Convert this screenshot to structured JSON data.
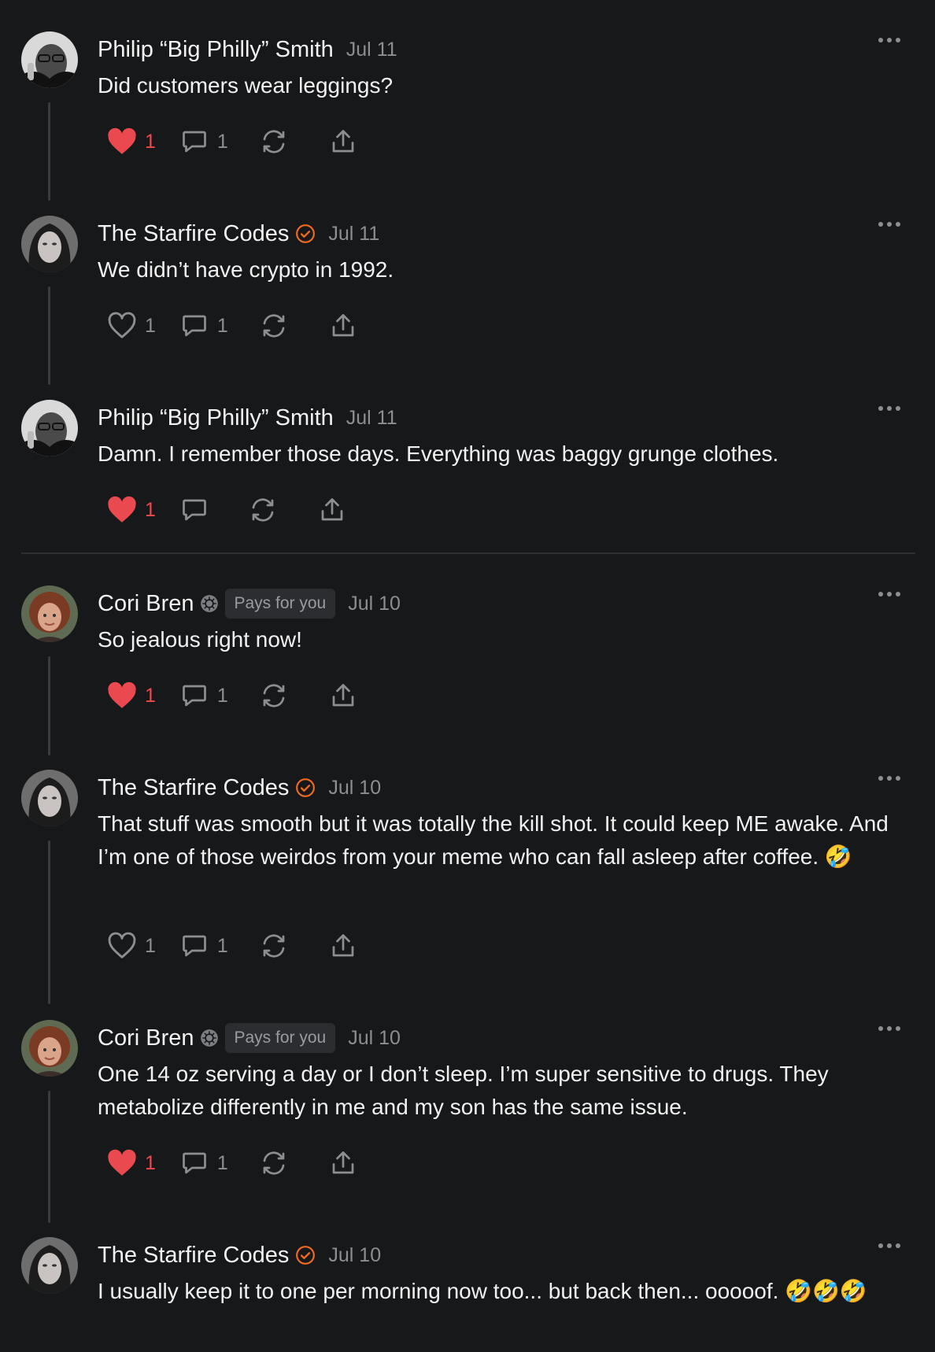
{
  "comments": [
    {
      "author": "Philip “Big Philly” Smith",
      "date": "Jul 11",
      "text": "Did customers wear leggings?",
      "likes": "1",
      "liked": true,
      "replies": "1",
      "avatar": "avatar-philip-icon"
    },
    {
      "author": "The Starfire Codes",
      "date": "Jul 11",
      "text": "We didn’t have crypto in 1992.",
      "likes": "1",
      "liked": false,
      "replies": "1",
      "avatar": "avatar-starfire-icon",
      "verified": true
    },
    {
      "author": "Philip “Big Philly” Smith",
      "date": "Jul 11",
      "text": "Damn. I remember those days. Everything was baggy grunge clothes.",
      "likes": "1",
      "liked": true,
      "replies": "",
      "avatar": "avatar-philip-icon"
    },
    {
      "author": "Cori Bren",
      "date": "Jul 10",
      "badge": "Pays for you",
      "text": "So jealous right now!",
      "likes": "1",
      "liked": true,
      "replies": "1",
      "avatar": "avatar-cori-icon"
    },
    {
      "author": "The Starfire Codes",
      "date": "Jul 10",
      "text": "That stuff was smooth but it was totally the kill shot. It could keep ME awake. And I’m one of those weirdos from your meme who can fall asleep after coffee. 🤣",
      "likes": "1",
      "liked": false,
      "replies": "1",
      "avatar": "avatar-starfire-icon",
      "verified": true
    },
    {
      "author": "Cori Bren",
      "date": "Jul 10",
      "badge": "Pays for you",
      "text": "One 14 oz serving a day or I don’t sleep. I’m super sensitive to drugs. They metabolize differently in me and my son has the same issue.",
      "likes": "1",
      "liked": true,
      "replies": "1",
      "avatar": "avatar-cori-icon"
    },
    {
      "author": "The Starfire Codes",
      "date": "Jul 10",
      "text": "I usually keep it to one per morning now too... but back then... ooooof. 🤣🤣🤣",
      "avatar": "avatar-starfire-icon",
      "verified": true
    }
  ],
  "colors": {
    "background": "#17181a",
    "like": "#ea4a4f",
    "verified": "#f06a23",
    "muted": "#8d8e92"
  }
}
